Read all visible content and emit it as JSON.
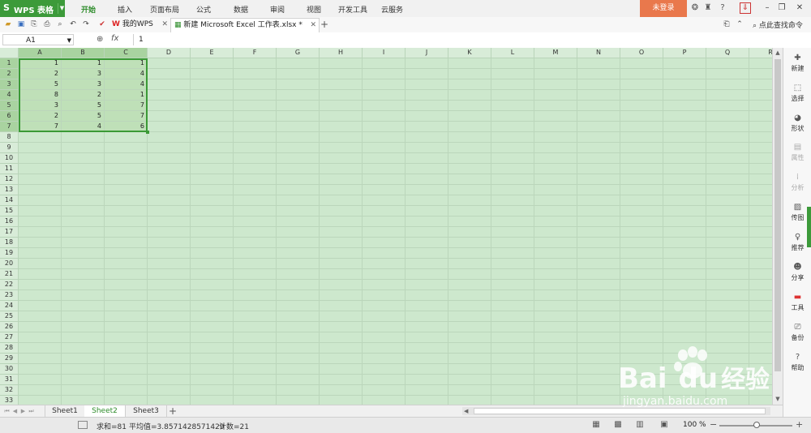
{
  "app": {
    "title": "WPS 表格",
    "logo_icon": "wps-logo-icon",
    "brand_color": "#3c9a3a"
  },
  "menu": [
    "开始",
    "插入",
    "页面布局",
    "公式",
    "数据",
    "审阅",
    "视图",
    "开发工具",
    "云服务"
  ],
  "login_label": "未登录",
  "tabs": {
    "mywps": "我的WPS",
    "file": "新建 Microsoft Excel 工作表.xlsx *"
  },
  "command_search": "点此查找命令",
  "namebox": "A1",
  "formula": {
    "fx": "fx",
    "value": "1"
  },
  "columns": [
    "A",
    "B",
    "C",
    "D",
    "E",
    "F",
    "G",
    "H",
    "I",
    "J",
    "K",
    "L",
    "M",
    "N",
    "O",
    "P",
    "Q",
    "R"
  ],
  "rows": [
    "1",
    "2",
    "3",
    "4",
    "5",
    "6",
    "7",
    "8",
    "9",
    "10",
    "11",
    "12",
    "13",
    "14",
    "15",
    "16",
    "17",
    "18",
    "19",
    "20",
    "21",
    "22",
    "23",
    "24",
    "25",
    "26",
    "27",
    "28",
    "29",
    "30",
    "31",
    "32",
    "33"
  ],
  "cells": [
    [
      "1",
      "1",
      "1"
    ],
    [
      "2",
      "3",
      "4"
    ],
    [
      "5",
      "3",
      "4"
    ],
    [
      "8",
      "2",
      "1"
    ],
    [
      "3",
      "5",
      "7"
    ],
    [
      "2",
      "5",
      "7"
    ],
    [
      "7",
      "4",
      "6"
    ]
  ],
  "sidebar": [
    "新建",
    "选择",
    "形状",
    "属性",
    "分析",
    "传图",
    "推荐",
    "分享",
    "工具",
    "备份",
    "帮助"
  ],
  "sheets": [
    "Sheet1",
    "Sheet2",
    "Sheet3"
  ],
  "active_sheet": "Sheet2",
  "status": {
    "sum": "求和=81",
    "avg": "平均值=3.8571428571429",
    "count": "计数=21"
  },
  "zoom": "100 %",
  "zoom_level": 1.0,
  "watermark": {
    "brand": "Bai",
    "brand2": "du",
    "cn": "经验",
    "url": "jingyan.baidu.com"
  }
}
